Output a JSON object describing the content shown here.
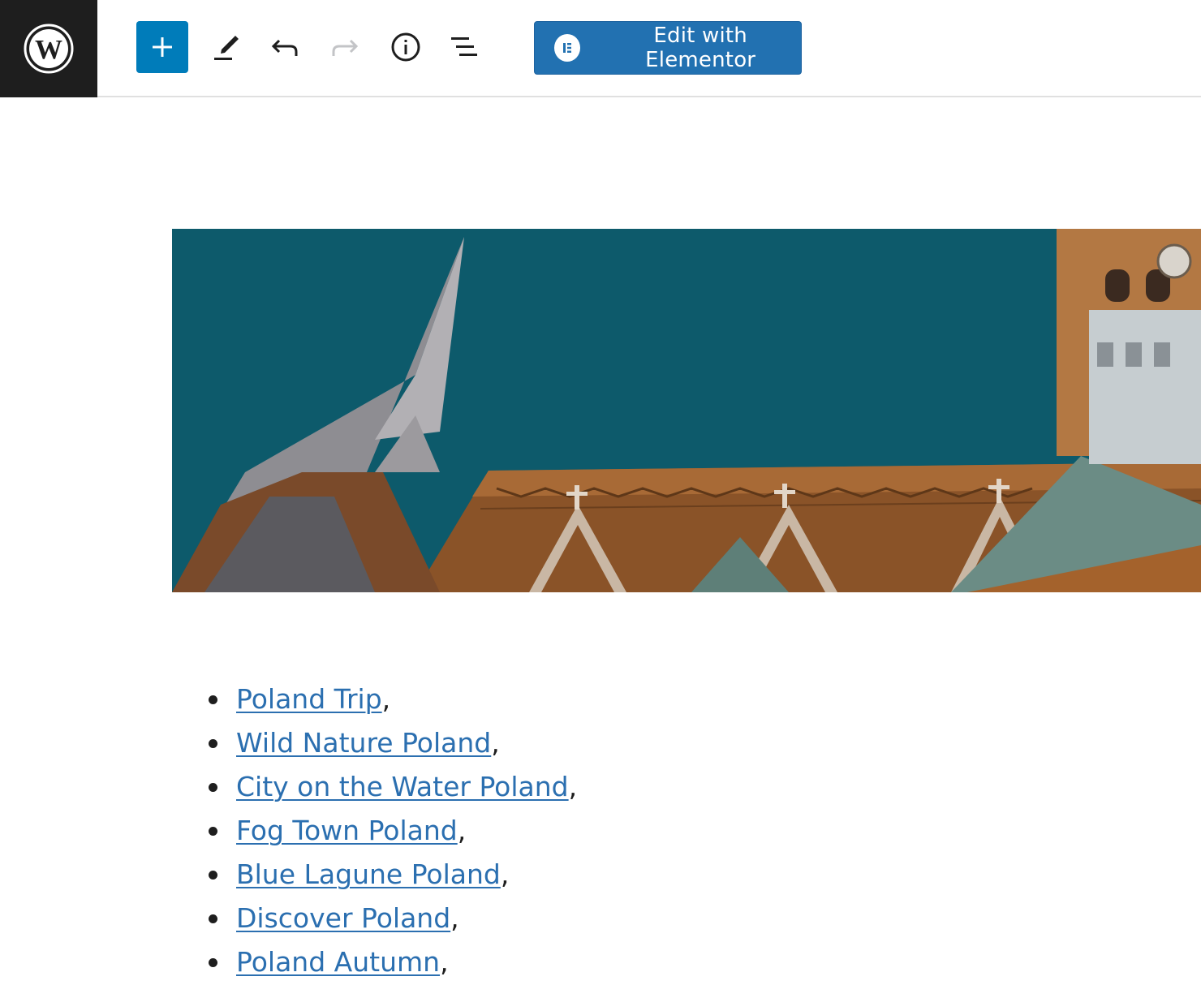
{
  "toolbar": {
    "logo_icon": "wordpress-logo-icon",
    "add_icon": "plus-icon",
    "tools_icon": "pencil-icon",
    "undo_icon": "undo-icon",
    "redo_icon": "redo-icon",
    "info_icon": "info-icon",
    "outline_icon": "list-view-icon",
    "elementor_label": "Edit with Elementor",
    "elementor_icon": "elementor-icon"
  },
  "colors": {
    "primary": "#007cba",
    "elementor": "#2271b1",
    "link": "#2b6fb0",
    "logo_bg": "#1e1e1e"
  },
  "tags": [
    {
      "label": "Poland Trip",
      "suffix": ","
    },
    {
      "label": "Wild Nature Poland",
      "suffix": ","
    },
    {
      "label": "City on the Water Poland",
      "suffix": ","
    },
    {
      "label": "Fog Town Poland",
      "suffix": ","
    },
    {
      "label": "Blue Lagune Poland",
      "suffix": ","
    },
    {
      "label": "Discover Poland",
      "suffix": ","
    },
    {
      "label": "Poland Autumn",
      "suffix": ","
    }
  ]
}
